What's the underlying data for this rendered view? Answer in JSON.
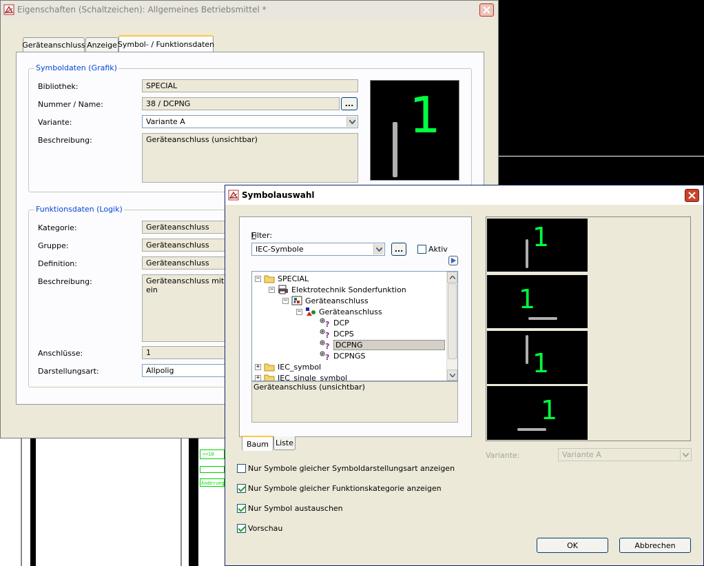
{
  "props_window": {
    "title": "Eigenschaften (Schaltzeichen): Allgemeines Betriebsmittel *",
    "tabs": [
      "Geräteanschluss",
      "Anzeige",
      "Symbol- / Funktionsdaten"
    ],
    "active_tab": "Symbol- / Funktionsdaten",
    "symbol_group": {
      "title": "Symboldaten (Grafik)",
      "library_label": "Bibliothek:",
      "library_value": "SPECIAL",
      "number_label": "Nummer / Name:",
      "number_value": "38 / DCPNG",
      "browse_label": "...",
      "variant_label": "Variante:",
      "variant_value": "Variante A",
      "desc_label": "Beschreibung:",
      "desc_value": "Geräteanschluss (unsichtbar)"
    },
    "function_group": {
      "title": "Funktionsdaten (Logik)",
      "category_label": "Kategorie:",
      "category_value": "Geräteanschluss",
      "group_label": "Gruppe:",
      "group_value": "Geräteanschluss",
      "definition_label": "Definition:",
      "definition_value": "Geräteanschluss",
      "desc_label": "Beschreibung:",
      "desc_value": "Geräteanschluss mit ein",
      "connections_label": "Anschlüsse:",
      "connections_value": "1",
      "display_label": "Darstellungsart:",
      "display_value": "Allpolig"
    },
    "preview_number": "1"
  },
  "symbol_window": {
    "title": "Symbolauswahl",
    "filter_label": "Filter:",
    "filter_value": "IEC-Symbole",
    "filter_browse": "...",
    "aktiv_label": "Aktiv",
    "tree": [
      {
        "label": "SPECIAL",
        "expander": "−",
        "icon": "folder-icon"
      },
      {
        "label": "Elektrotechnik Sonderfunktion",
        "expander": "−",
        "icon": "printer-icon"
      },
      {
        "label": "Geräteanschluss",
        "expander": "−",
        "icon": "function-icon"
      },
      {
        "label": "Geräteanschluss",
        "expander": "−",
        "icon": "shapes-icon"
      },
      {
        "label": "DCP",
        "icon": "symbol-icon"
      },
      {
        "label": "DCPS",
        "icon": "symbol-icon"
      },
      {
        "label": "DCPNG",
        "icon": "symbol-icon",
        "selected": true
      },
      {
        "label": "DCPNGS",
        "icon": "symbol-icon"
      },
      {
        "label": "IEC_symbol",
        "expander": "+",
        "icon": "folder-icon"
      },
      {
        "label": "IEC_single_symbol",
        "expander": "+",
        "icon": "folder-icon"
      }
    ],
    "description": "Geräteanschluss (unsichtbar)",
    "bottom_tabs": [
      "Baum",
      "Liste"
    ],
    "active_bottom_tab": "Baum",
    "preview_number": "1",
    "variant_label": "Variante:",
    "variant_value": "Variante A",
    "options": [
      {
        "label": "Nur Symbole gleicher Symboldarstellungsart anzeigen",
        "checked": false
      },
      {
        "label": "Nur Symbole gleicher Funktionskategorie anzeigen",
        "checked": true
      },
      {
        "label": "Nur Symbol austauschen",
        "checked": true
      },
      {
        "label": "Vorschau",
        "checked": true
      }
    ],
    "ok_label": "OK",
    "cancel_label": "Abbrechen"
  },
  "background": {
    "label_1": "<<10",
    "label_2": "Änderung"
  },
  "colors": {
    "preview_green": "#00ff40",
    "group_title_blue": "#0046d5"
  }
}
